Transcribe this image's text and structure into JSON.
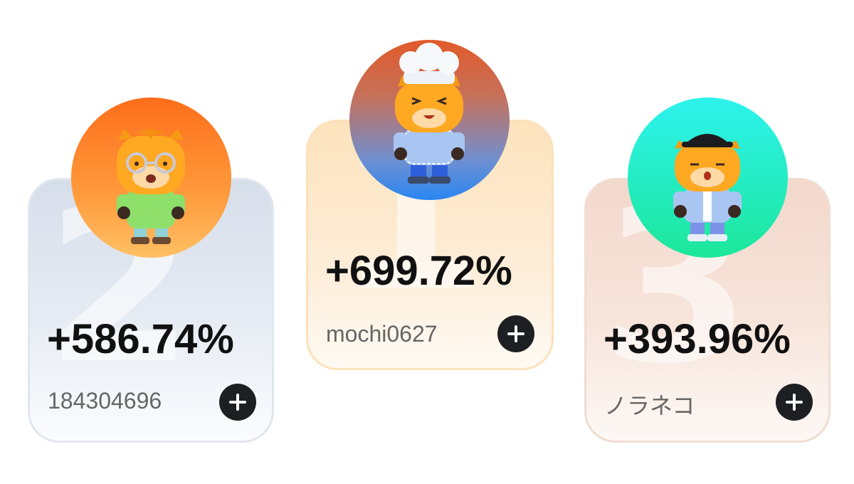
{
  "leaderboard": [
    {
      "rank": "1",
      "percent": "+699.72%",
      "username": "mochi0627",
      "avatar_icon": "mascot-chef-icon",
      "avatar_colors": [
        "#e15a2a",
        "#2a86f2"
      ]
    },
    {
      "rank": "2",
      "percent": "+586.74%",
      "username": "184304696",
      "avatar_icon": "mascot-glasses-icon",
      "avatar_colors": [
        "#fe6e1a",
        "#ffc064"
      ]
    },
    {
      "rank": "3",
      "percent": "+393.96%",
      "username": "ノラネコ",
      "avatar_icon": "mascot-cap-icon",
      "avatar_colors": [
        "#2df2ee",
        "#1de79a"
      ]
    }
  ],
  "add_button_icon": "plus-icon"
}
